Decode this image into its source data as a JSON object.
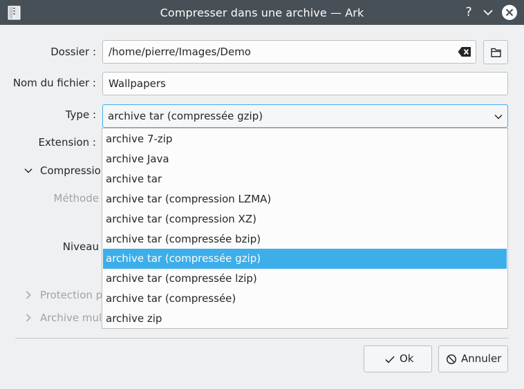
{
  "window": {
    "title": "Compresser dans une archive — Ark",
    "help_glyph": "?"
  },
  "form": {
    "folder_label": "Dossier :",
    "folder_value": "/home/pierre/Images/Demo",
    "filename_label": "Nom du fichier :",
    "filename_value": "Wallpapers",
    "type_label": "Type :",
    "type_value": "archive tar (compressée gzip)",
    "extension_label": "Extension :",
    "compression_label": "Compression",
    "method_label": "Méthode",
    "level_label": "Niveau",
    "protection_label": "Protection p",
    "multivolume_label": "Archive mult"
  },
  "dropdown": {
    "selected_index": 6,
    "options": [
      "archive 7-zip",
      "archive Java",
      "archive tar",
      "archive tar (compression LZMA)",
      "archive tar (compression XZ)",
      "archive tar (compressée bzip)",
      "archive tar (compressée gzip)",
      "archive tar (compressée lzip)",
      "archive tar (compressée)",
      "archive zip"
    ]
  },
  "buttons": {
    "ok_label": "Ok",
    "cancel_label": "Annuler"
  },
  "colors": {
    "titlebar": "#475057",
    "accent": "#3daee9",
    "window_bg": "#eff0f1",
    "text": "#232629",
    "disabled_text": "#a0a3a6"
  }
}
